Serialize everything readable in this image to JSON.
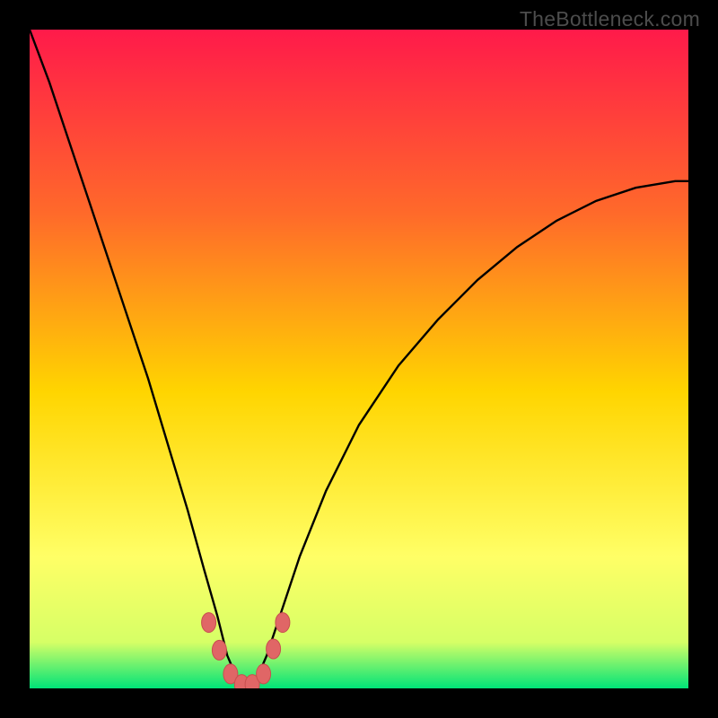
{
  "watermark": "TheBottleneck.com",
  "colors": {
    "frame": "#000000",
    "grad_top": "#ff1a4a",
    "grad_mid1": "#ff6a2a",
    "grad_mid2": "#ffd500",
    "grad_low1": "#ffff66",
    "grad_low2": "#d6ff66",
    "grad_bottom": "#00e378",
    "curve": "#000000",
    "marker_fill": "#e06666",
    "marker_stroke": "#c84f4f"
  },
  "chart_data": {
    "type": "line",
    "title": "",
    "xlabel": "",
    "ylabel": "",
    "xlim": [
      0,
      100
    ],
    "ylim": [
      0,
      100
    ],
    "note": "Bottleneck-percentage curve. x is relative position across panel (0-100), y is percentage (0 at bottom green band, 100 at top red). Valley near x≈33 at y≈0. Values estimated from pixels.",
    "series": [
      {
        "name": "bottleneck-curve",
        "x": [
          0,
          3,
          6,
          9,
          12,
          15,
          18,
          21,
          24,
          26.5,
          28.5,
          30,
          31.5,
          33,
          34.5,
          36,
          38,
          41,
          45,
          50,
          56,
          62,
          68,
          74,
          80,
          86,
          92,
          98,
          100
        ],
        "y": [
          100,
          92,
          83,
          74,
          65,
          56,
          47,
          37,
          27,
          18,
          11,
          5,
          1.5,
          0,
          1.5,
          5,
          11,
          20,
          30,
          40,
          49,
          56,
          62,
          67,
          71,
          74,
          76,
          77,
          77
        ]
      }
    ],
    "markers": {
      "name": "highlight-points",
      "x": [
        27.2,
        28.8,
        30.5,
        32.2,
        33.8,
        35.5,
        37.0,
        38.4
      ],
      "y": [
        10.0,
        5.8,
        2.2,
        0.6,
        0.6,
        2.2,
        6.0,
        10.0
      ]
    }
  }
}
